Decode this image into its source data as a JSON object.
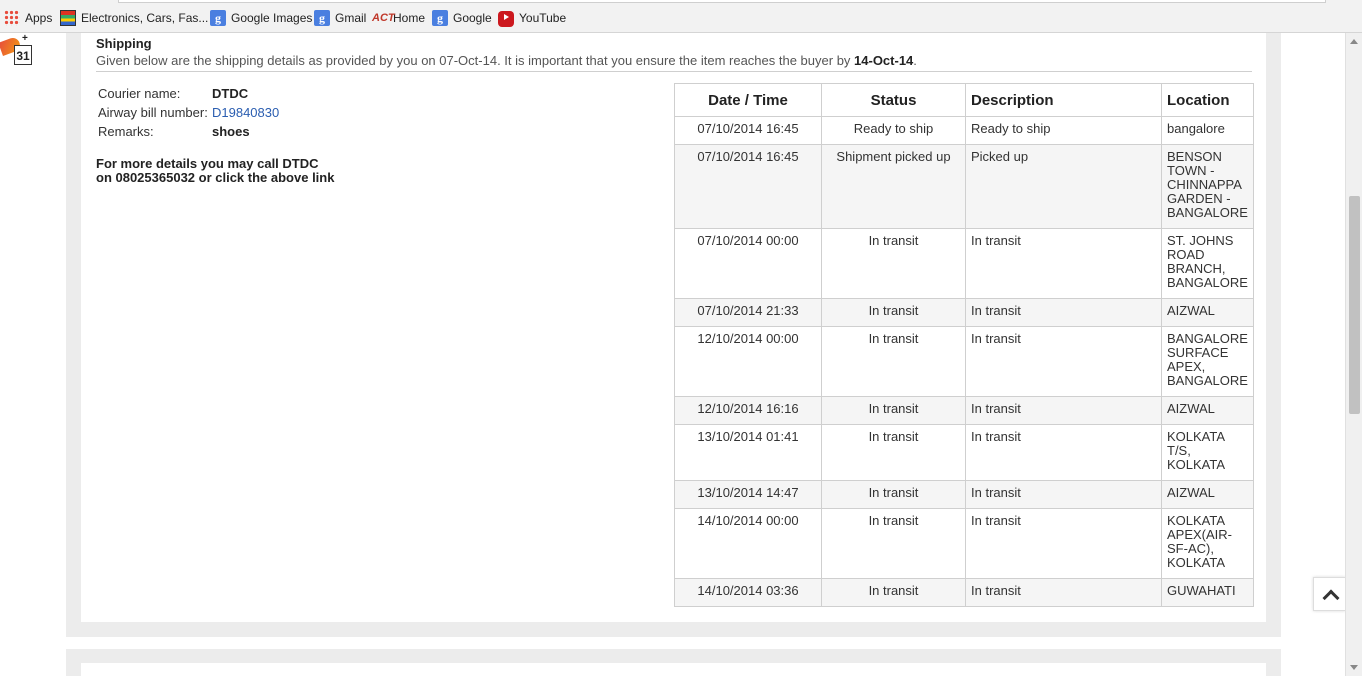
{
  "bookmarks": [
    {
      "label": "Apps",
      "icon": "apps-grid-icon"
    },
    {
      "label": "Electronics, Cars, Fas...",
      "icon": "shopping-icon"
    },
    {
      "label": "Google Images",
      "icon": "google-icon"
    },
    {
      "label": "Gmail",
      "icon": "google-icon"
    },
    {
      "label": "Home",
      "icon": "act-icon"
    },
    {
      "label": "Google",
      "icon": "google-icon"
    },
    {
      "label": "YouTube",
      "icon": "youtube-icon"
    }
  ],
  "calendar_widget": {
    "day": "31",
    "plus": "+"
  },
  "shipping": {
    "title": "Shipping",
    "desc_prefix": "Given below are the shipping details as provided by you on 07-Oct-14. It is important that you ensure the item reaches the buyer by ",
    "desc_date": "14-Oct-14",
    "desc_suffix": ".",
    "courier_label": "Courier name:",
    "courier_value": "DTDC",
    "airway_label": "Airway bill number:",
    "airway_value": "D19840830",
    "remarks_label": "Remarks:",
    "remarks_value": "shoes",
    "call_line1": "For more details you may call DTDC",
    "call_line2": "on 08025365032 or click the above link"
  },
  "tracking": {
    "headers": [
      "Date / Time",
      "Status",
      "Description",
      "Location"
    ],
    "rows": [
      [
        "07/10/2014 16:45",
        "Ready to ship",
        "Ready to ship",
        "bangalore"
      ],
      [
        "07/10/2014 16:45",
        "Shipment picked up",
        "Picked up",
        "BENSON TOWN - CHINNAPPA GARDEN - BANGALORE"
      ],
      [
        "07/10/2014 00:00",
        "In transit",
        "In transit",
        "ST. JOHNS ROAD BRANCH, BANGALORE"
      ],
      [
        "07/10/2014 21:33",
        "In transit",
        "In transit",
        "AIZWAL"
      ],
      [
        "12/10/2014 00:00",
        "In transit",
        "In transit",
        "BANGALORE SURFACE APEX, BANGALORE"
      ],
      [
        "12/10/2014 16:16",
        "In transit",
        "In transit",
        "AIZWAL"
      ],
      [
        "13/10/2014 01:41",
        "In transit",
        "In transit",
        "KOLKATA T/S, KOLKATA"
      ],
      [
        "13/10/2014 14:47",
        "In transit",
        "In transit",
        "AIZWAL"
      ],
      [
        "14/10/2014 00:00",
        "In transit",
        "In transit",
        "KOLKATA APEX(AIR-SF-AC), KOLKATA"
      ],
      [
        "14/10/2014 03:36",
        "In transit",
        "In transit",
        "GUWAHATI"
      ]
    ]
  }
}
